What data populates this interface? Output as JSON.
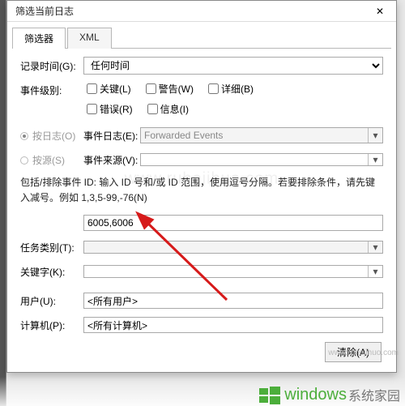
{
  "window": {
    "title": "筛选当前日志",
    "close_glyph": "✕"
  },
  "tabs": {
    "items": [
      "筛选器",
      "XML"
    ],
    "active_index": 0
  },
  "form": {
    "logged_label": "记录时间(G):",
    "logged_value": "任何时间",
    "level_label": "事件级别:",
    "level_options": {
      "critical": "关键(L)",
      "warning": "警告(W)",
      "verbose": "详细(B)",
      "error": "错误(R)",
      "information": "信息(I)"
    },
    "bylog_label": "按日志(O)",
    "eventlog_label": "事件日志(E):",
    "eventlog_value": "Forwarded Events",
    "bysource_label": "按源(S)",
    "eventsource_label": "事件来源(V):",
    "eventsource_value": "",
    "id_instruction": "包括/排除事件 ID: 输入 ID 号和/或 ID 范围，使用逗号分隔。若要排除条件，请先键入减号。例如 1,3,5-99,-76(N)",
    "id_value": "6005,6006",
    "task_label": "任务类别(T):",
    "task_value": "",
    "keyword_label": "关键字(K):",
    "keyword_value": "",
    "user_label": "用户(U):",
    "user_value": "<所有用户>",
    "computer_label": "计算机(P):",
    "computer_value": "<所有计算机>",
    "clear_button": "清除(A)"
  },
  "branding": {
    "watermark": "www.ruhejihuo.com",
    "logo_text_1": "windows",
    "logo_text_2": "系统家园",
    "url": "www.ruhejihuo.com"
  },
  "icons": {
    "dropdown_glyph": "▾"
  }
}
